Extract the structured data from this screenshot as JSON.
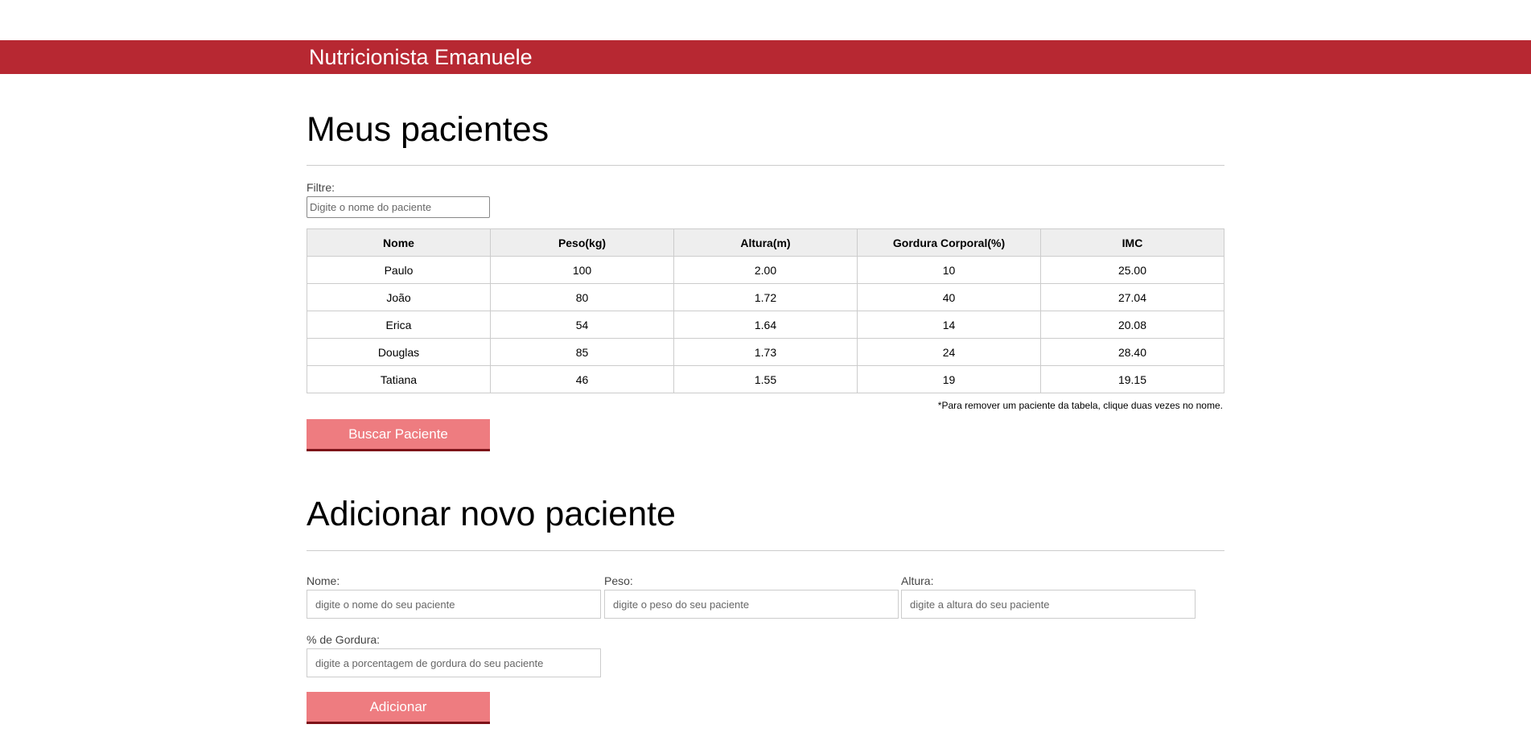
{
  "header": {
    "title": "Nutricionista Emanuele"
  },
  "patients_section": {
    "title": "Meus pacientes",
    "filter_label": "Filtre:",
    "filter_placeholder": "Digite o nome do paciente",
    "columns": [
      "Nome",
      "Peso(kg)",
      "Altura(m)",
      "Gordura Corporal(%)",
      "IMC"
    ],
    "rows": [
      [
        "Paulo",
        "100",
        "2.00",
        "10",
        "25.00"
      ],
      [
        "João",
        "80",
        "1.72",
        "40",
        "27.04"
      ],
      [
        "Erica",
        "54",
        "1.64",
        "14",
        "20.08"
      ],
      [
        "Douglas",
        "85",
        "1.73",
        "24",
        "28.40"
      ],
      [
        "Tatiana",
        "46",
        "1.55",
        "19",
        "19.15"
      ]
    ],
    "remove_note": "*Para remover um paciente da tabela, clique duas vezes no nome.",
    "search_button": "Buscar Paciente"
  },
  "add_section": {
    "title": "Adicionar novo paciente",
    "nome_label": "Nome:",
    "nome_placeholder": "digite o nome do seu paciente",
    "peso_label": "Peso:",
    "peso_placeholder": "digite o peso do seu paciente",
    "altura_label": "Altura:",
    "altura_placeholder": "digite a altura do seu paciente",
    "gordura_label": "% de Gordura:",
    "gordura_placeholder": "digite a porcentagem de gordura do seu paciente",
    "add_button": "Adicionar"
  },
  "colors": {
    "header_bg": "#b72832",
    "button_bg": "#ee7c80",
    "button_border": "#7e1219"
  }
}
